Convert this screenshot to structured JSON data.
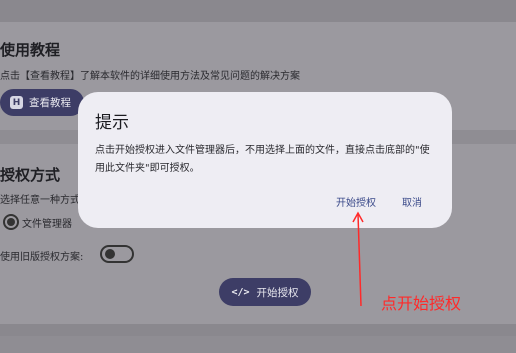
{
  "tutorial": {
    "title": "使用教程",
    "description": "点击【查看教程】了解本软件的详细使用方法及常见问题的解决方案",
    "button_label": "查看教程",
    "button_icon": "H"
  },
  "authorization": {
    "title": "授权方式",
    "hint": "选择任意一种方式",
    "option_label": "文件管理器",
    "legacy_label": "使用旧版授权方案:",
    "legacy_enabled": false,
    "start_button_label": "开始授权",
    "start_button_icon": "</>"
  },
  "dialog": {
    "title": "提示",
    "message": "点击开始授权进入文件管理器后，不用选择上面的文件，直接点击底部的\"使用此文件夹\"即可授权。",
    "confirm_label": "开始授权",
    "cancel_label": "取消"
  },
  "annotation": {
    "text": "点开始授权",
    "color": "#ff2a2a"
  },
  "colors": {
    "accent": "#3d3d66",
    "dialog_button": "#3b4a8a"
  }
}
